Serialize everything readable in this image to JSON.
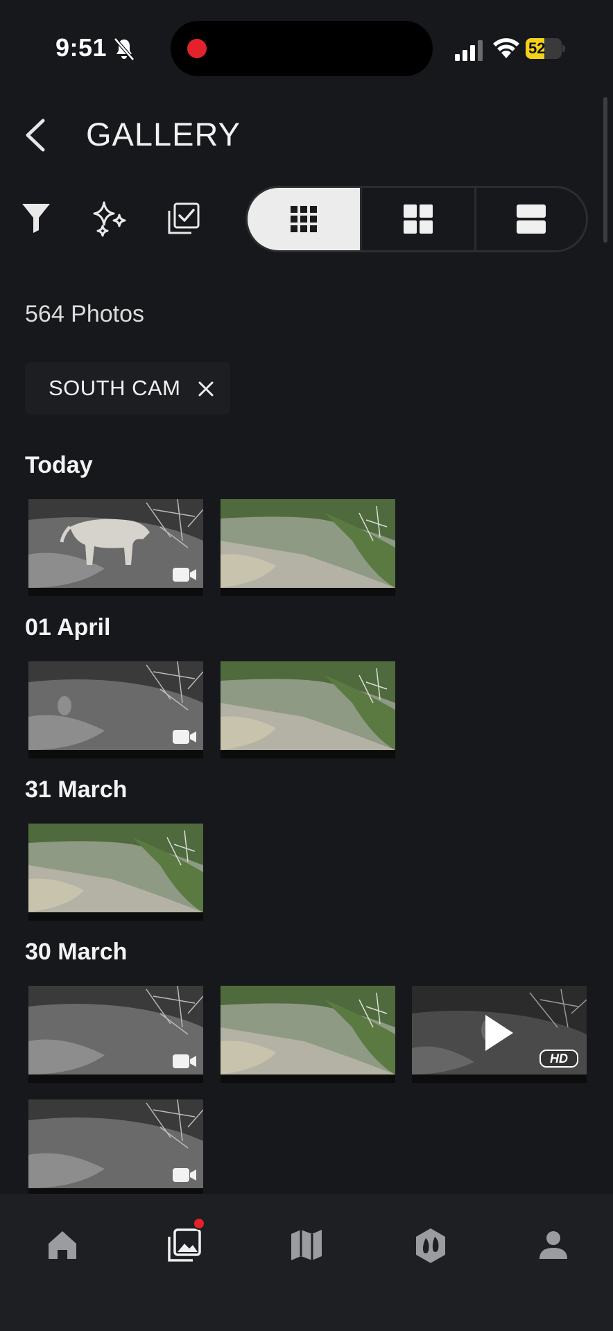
{
  "status_bar": {
    "time": "9:51",
    "battery": "52",
    "battery_level": 0.52,
    "icons": [
      "bell-slash-icon",
      "recording-dot-icon",
      "cellular-signal-icon",
      "wifi-icon",
      "battery-charging-icon"
    ]
  },
  "header": {
    "title": "GALLERY",
    "back_icon": "chevron-left-icon"
  },
  "toolbar": {
    "icons": [
      "filter-icon",
      "sparkles-icon",
      "select-checkbox-icon"
    ],
    "view_modes": [
      {
        "name": "small-grid",
        "icon": "grid-3x3-icon",
        "active": true
      },
      {
        "name": "medium-grid",
        "icon": "grid-2x2-icon",
        "active": false
      },
      {
        "name": "list",
        "icon": "list-rows-icon",
        "active": false
      }
    ]
  },
  "photo_count": "564 Photos",
  "filter_chip": {
    "label": "SOUTH CAM",
    "close_icon": "close-icon"
  },
  "sections": [
    {
      "title": "Today",
      "items": [
        {
          "kind": "video",
          "scene": "night",
          "subject": "cougar"
        },
        {
          "kind": "photo",
          "scene": "day"
        }
      ]
    },
    {
      "title": "01 April",
      "items": [
        {
          "kind": "video",
          "scene": "night",
          "subject": "rabbit"
        },
        {
          "kind": "photo",
          "scene": "day"
        }
      ]
    },
    {
      "title": "31 March",
      "items": [
        {
          "kind": "photo",
          "scene": "day"
        }
      ]
    },
    {
      "title": "30 March",
      "items": [
        {
          "kind": "video",
          "scene": "night"
        },
        {
          "kind": "photo",
          "scene": "day"
        },
        {
          "kind": "hd-video",
          "scene": "night-dark",
          "subject": "fox"
        },
        {
          "kind": "video",
          "scene": "night"
        }
      ]
    }
  ],
  "bottom_nav": {
    "items": [
      {
        "name": "home",
        "icon": "home-icon",
        "active": false
      },
      {
        "name": "gallery",
        "icon": "gallery-icon",
        "active": true,
        "badge": true
      },
      {
        "name": "map",
        "icon": "map-icon",
        "active": false
      },
      {
        "name": "hunt",
        "icon": "hoof-badge-icon",
        "active": false
      },
      {
        "name": "profile",
        "icon": "person-icon",
        "active": false
      }
    ]
  },
  "colors": {
    "background": "#16181b",
    "nav_background": "#1d1f22",
    "accent_red": "#e3222b",
    "battery_yellow": "#f2d21a",
    "active_toggle": "#ececec"
  }
}
